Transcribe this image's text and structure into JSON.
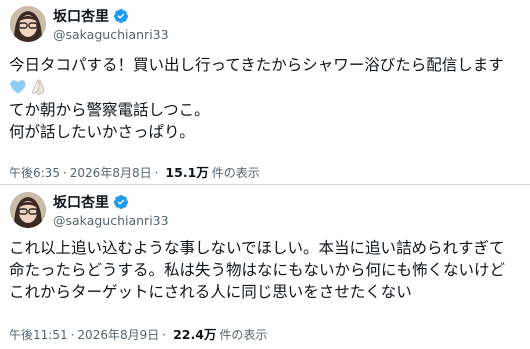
{
  "tweets": [
    {
      "display_name": "坂口杏里",
      "handle": "@sakaguchianri33",
      "lines": [
        "今日タコパする！買い出し行ってきたからシャワー浴びたら配信します",
        "てか朝から警察電話しつこ。",
        "何が話したいかさっぱり。"
      ],
      "emojis": [
        "light-blue-heart-icon",
        "folded-hands-icon"
      ],
      "time": "午後6:35",
      "date": "2026年8月8日",
      "views": "15.1万",
      "views_label": "件の表示"
    },
    {
      "display_name": "坂口杏里",
      "handle": "@sakaguchianri33",
      "lines": [
        "これ以上追い込むような事しないでほしい。本当に追い詰められすぎて",
        "命たったらどうする。私は失う物はなにもないから何にも怖くないけど",
        "これからターゲットにされる人に同じ思いをさせたくない"
      ],
      "time": "午後11:51",
      "date": "2026年8月9日",
      "views": "22.4万",
      "views_label": "件の表示"
    }
  ],
  "separator": "·",
  "colors": {
    "text": "#0f1419",
    "secondary": "#536471",
    "verified": "#1d9bf0",
    "divider": "#cfd9de",
    "heart": "#8ecdf6"
  }
}
